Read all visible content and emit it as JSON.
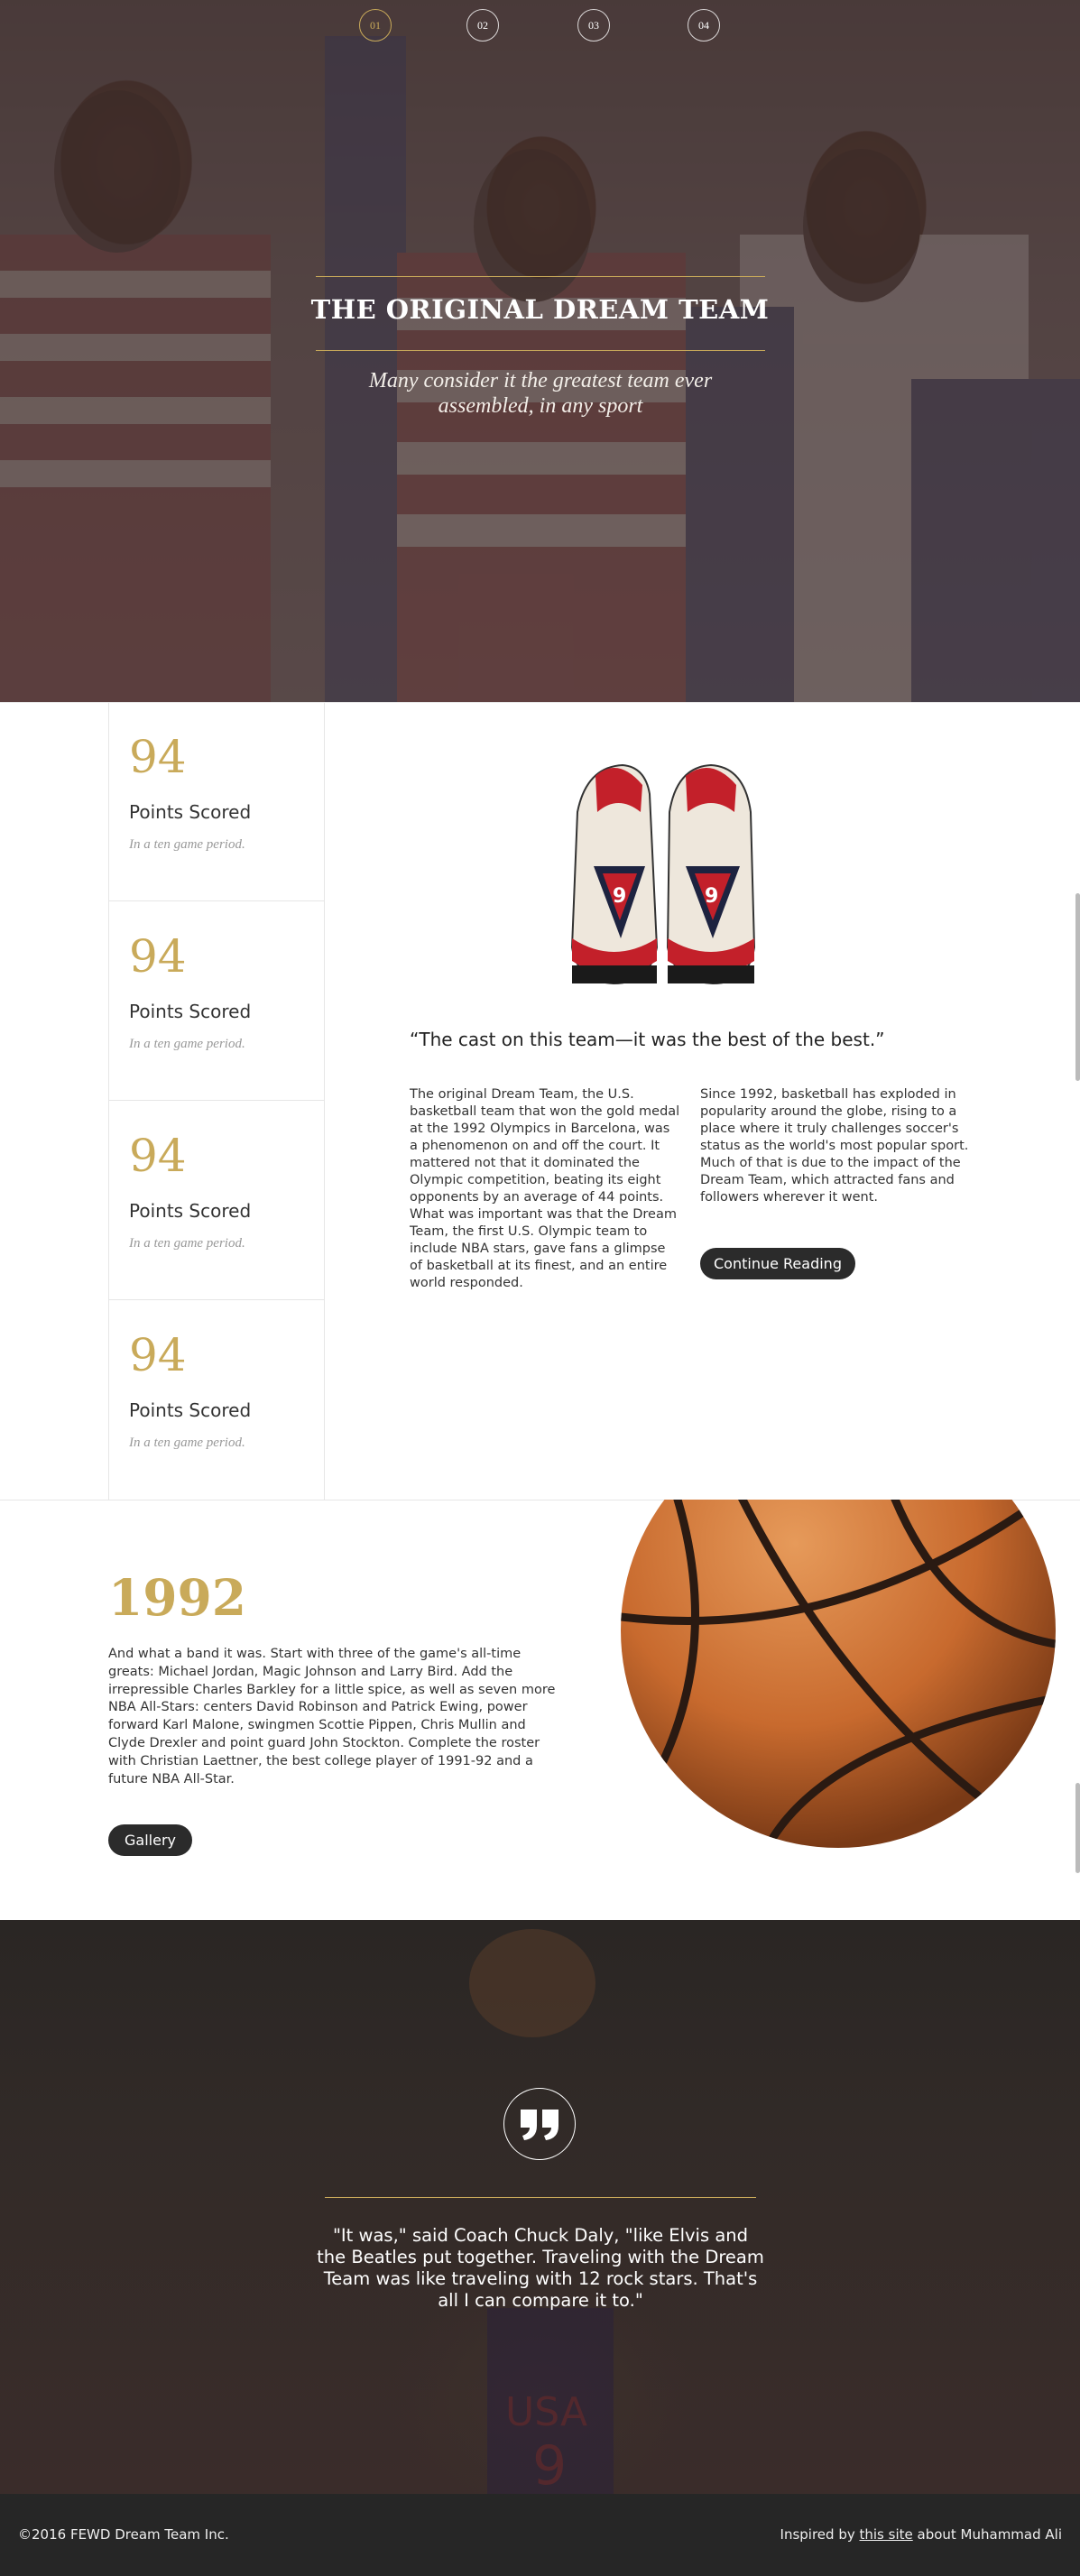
{
  "nav": {
    "dots": [
      "01",
      "02",
      "03",
      "04"
    ]
  },
  "hero": {
    "title": "THE ORIGINAL DREAM TEAM",
    "subtitle": "Many consider it the greatest team ever assembled, in any sport"
  },
  "stats": [
    {
      "value": "94",
      "label": "Points Scored",
      "note": "In a ten game period."
    },
    {
      "value": "94",
      "label": "Points Scored",
      "note": "In a ten game period."
    },
    {
      "value": "94",
      "label": "Points Scored",
      "note": "In a ten game period."
    },
    {
      "value": "94",
      "label": "Points Scored",
      "note": "In a ten game period."
    }
  ],
  "article": {
    "quote": "“The cast on this team—it was the best of the best.”",
    "col1": "The original Dream Team, the U.S. basketball team that won the gold medal at the 1992 Olympics in Barcelona, was a phenomenon on and off the court. It mattered not that it dominated the Olympic competition, beating its eight opponents by an average of 44 points. What was important was that the Dream Team, the first U.S. Olympic team to include NBA stars, gave fans a glimpse of basketball at its finest, and an entire world responded.",
    "col2": "Since 1992, basketball has exploded in popularity around the globe, rising to a place where it truly challenges soccer's status as the world's most popular sport. Much of that is due to the impact of the Dream Team, which attracted fans and followers wherever it went.",
    "button": "Continue Reading"
  },
  "history": {
    "year": "1992",
    "text": "And what a band it was. Start with three of the game's all-time greats: Michael Jordan, Magic Johnson and Larry Bird. Add the irrepressible Charles Barkley for a little spice, as well as seven more NBA All-Stars: centers David Robinson and Patrick Ewing, power forward Karl Malone, swingmen Scottie Pippen, Chris Mullin and Clyde Drexler and point guard John Stockton. Complete the roster with Christian Laettner, the best college player of 1991-92 and a future NBA All-Star.",
    "button": "Gallery"
  },
  "quote_section": {
    "text": "\"It was,\" said Coach Chuck Daly, \"like Elvis and the Beatles put together. Traveling with the Dream Team was like traveling with 12 rock stars. That's all I can compare it to.\""
  },
  "footer": {
    "copyright": "©2016 FEWD Dream Team Inc.",
    "inspired_prefix": "Inspired by ",
    "link_text": "this site",
    "inspired_suffix": " about Muhammad Ali"
  },
  "colors": {
    "accent": "#c9aa5a",
    "dark": "#2b2b2b",
    "footer": "#262626"
  }
}
